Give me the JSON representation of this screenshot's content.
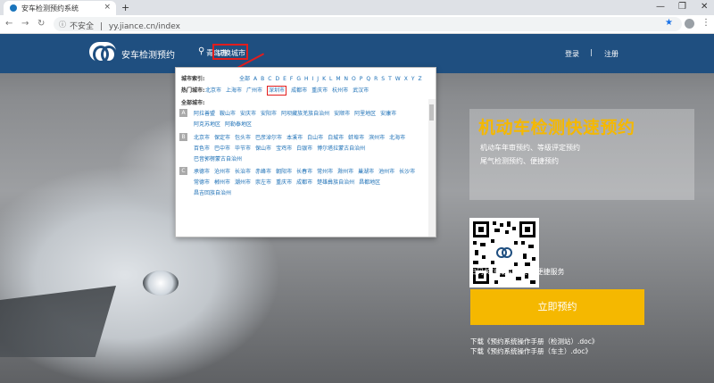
{
  "browser": {
    "tab_title": "安车检测预约系统",
    "tab_close": "×",
    "new_tab": "+",
    "insecure_label": "不安全",
    "separator": "|",
    "url": "yy.jiance.cn/index",
    "min": "—",
    "max": "❐",
    "close": "✕",
    "back": "←",
    "forward": "→",
    "reload": "↻"
  },
  "header": {
    "brand": "安车检测预约",
    "current_city": "青岛市",
    "switch_city": "切换城市",
    "login": "登录",
    "divider": "|",
    "register": "注册"
  },
  "city_picker": {
    "index_label": "城市索引:",
    "letters": [
      "全部",
      "A",
      "B",
      "C",
      "D",
      "E",
      "F",
      "G",
      "H",
      "I",
      "J",
      "K",
      "L",
      "M",
      "N",
      "O",
      "P",
      "Q",
      "R",
      "S",
      "T",
      "W",
      "X",
      "Y",
      "Z"
    ],
    "hot_label": "热门城市:",
    "hot_cities": [
      "北京市",
      "上海市",
      "广州市",
      "深圳市",
      "成都市",
      "重庆市",
      "杭州市",
      "武汉市"
    ],
    "selected_hot": "深圳市",
    "all_label": "全部城市:",
    "groups": [
      {
        "letter": "A",
        "cities": [
          "阿拉善盟",
          "鞍山市",
          "安庆市",
          "安阳市",
          "阿坝藏族羌族自治州",
          "安顺市",
          "阿里地区",
          "安康市",
          "阿克苏地区",
          "阿勒泰地区"
        ]
      },
      {
        "letter": "B",
        "cities": [
          "北京市",
          "保定市",
          "包头市",
          "巴彦淖尔市",
          "本溪市",
          "白山市",
          "白城市",
          "蚌埠市",
          "滨州市",
          "北海市",
          "百色市",
          "巴中市",
          "毕节市",
          "保山市",
          "宝鸡市",
          "白银市",
          "博尔塔拉蒙古自治州",
          "巴音郭楞蒙古自治州"
        ]
      },
      {
        "letter": "C",
        "cities": [
          "承德市",
          "沧州市",
          "长治市",
          "赤峰市",
          "朝阳市",
          "长春市",
          "常州市",
          "滁州市",
          "巢湖市",
          "池州市",
          "长沙市",
          "常德市",
          "郴州市",
          "潮州市",
          "崇左市",
          "重庆市",
          "成都市",
          "楚雄彝族自治州",
          "昌都地区",
          "昌吉回族自治州"
        ]
      }
    ]
  },
  "hero": {
    "headline": "机动车检测快速预约",
    "line1": "机动车年审预约、等级评定预约",
    "line2": "尾气检测预约、便捷预约",
    "scan_text": "扫码关注微信号 尽享便捷服务",
    "book_button": "立即预约",
    "download1": "下载《预约系统操作手册（检测站）.doc》",
    "download2": "下载《预约系统操作手册（车主）.doc》"
  },
  "colors": {
    "navbar": "#1f4f80",
    "accent": "#f5b800",
    "highlight": "#e21d1d",
    "link": "#1b6fb6"
  }
}
